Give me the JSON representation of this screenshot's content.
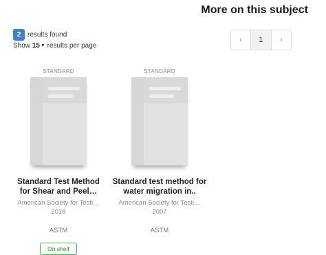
{
  "heading": "More on this subject",
  "results": {
    "count": "2",
    "label": "results found"
  },
  "per_page": {
    "prefix": "Show",
    "value": "15",
    "suffix": "results per page"
  },
  "pagination": {
    "prev": "‹",
    "current": "1",
    "next": "›"
  },
  "items": [
    {
      "type": "STANDARD",
      "title": "Standard Test Method for Shear and Peel…",
      "publisher": "American Society for Testi…",
      "year": "2018",
      "source": "ASTM",
      "availability": "On shelf"
    },
    {
      "type": "STANDARD",
      "title": "Standard test method for water migration in..",
      "publisher": "American Society for Testi…",
      "year": "2007",
      "source": "ASTM",
      "availability": ""
    }
  ]
}
